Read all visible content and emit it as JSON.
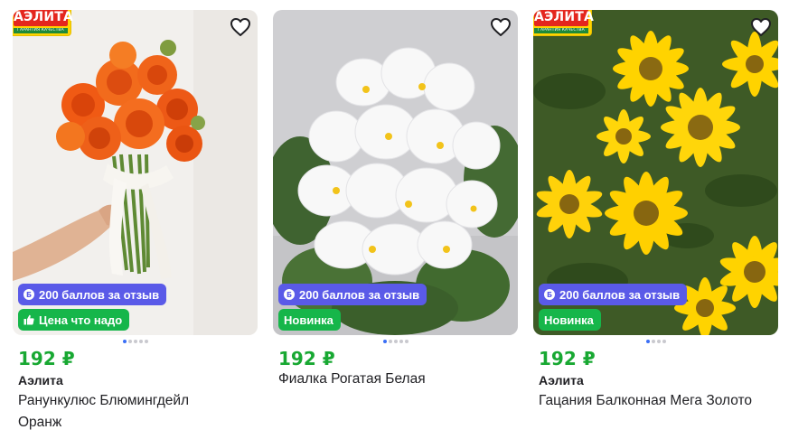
{
  "products": [
    {
      "price": "192 ₽",
      "brand": "Аэлита",
      "title_line1": "Ранункулюс Блюмингдейл",
      "title_line2": "Оранж",
      "bonus_badge": "200 баллов за отзыв",
      "status_badge": "Цена что надо",
      "logo_text": "АЭЛИТА",
      "logo_subtext": "ГАРАНТИЯ КАЧЕСТВА"
    },
    {
      "price": "192 ₽",
      "brand": "",
      "title_line1": "Фиалка Рогатая Белая",
      "title_line2": "",
      "bonus_badge": "200 баллов за отзыв",
      "status_badge": "Новинка"
    },
    {
      "price": "192 ₽",
      "brand": "Аэлита",
      "title_line1": "Гацания Балконная Мега Золото",
      "title_line2": "",
      "bonus_badge": "200 баллов за отзыв",
      "status_badge": "Новинка",
      "logo_text": "АЭЛИТА",
      "logo_subtext": "ГАРАНТИЯ КАЧЕСТВА"
    }
  ],
  "colors": {
    "price": "#18a832",
    "bonus_badge": "#5a5ae8",
    "status_badge": "#16b64a",
    "dot_active": "#3b6ff5"
  },
  "icons": [
    "heart-icon",
    "bonus-b-icon",
    "thumbs-up-icon"
  ]
}
